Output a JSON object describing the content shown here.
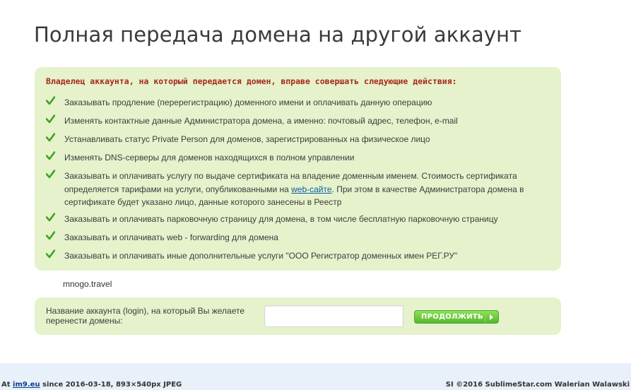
{
  "page": {
    "title": "Полная передача домена на другой аккаунт"
  },
  "rights": {
    "heading": "Владелец аккаунта, на который передается домен, вправе совершать следующие действия:",
    "items": [
      {
        "text": "Заказывать продление (перерегистрацию) доменного имени и оплачивать данную операцию"
      },
      {
        "text": "Изменять контактные данные Администратора домена, а именно: почтовый адрес, телефон, e-mail"
      },
      {
        "text": "Устанавливать статус Private Person для доменов, зарегистрированных на физическое лицо"
      },
      {
        "text": "Изменять DNS-серверы для доменов находящихся в полном управлении"
      },
      {
        "text_before": "Заказывать и оплачивать услугу по выдаче сертификата на владение доменным именем. Стоимость сертификата определяется тарифами на услуги, опубликованными на ",
        "link": "web-сайте",
        "text_after": ". При этом в качестве Администратора домена в сертификате будет указано лицо, данные которого занесены в Реестр"
      },
      {
        "text": "Заказывать и оплачивать парковочную страницу для домена, в том числе бесплатную парковочную страницу"
      },
      {
        "text": "Заказывать и оплачивать web - forwarding для домена"
      },
      {
        "text": "Заказывать и оплачивать иные дополнительные услуги \"ООО Регистратор доменных имен РЕГ.РУ\""
      }
    ]
  },
  "domain": {
    "name": "mnogo.travel"
  },
  "login_form": {
    "label": "Название аккаунта (login), на который Вы желаете перенести домены:",
    "input_value": "",
    "input_placeholder": "",
    "button_label": "ПРОДОЛЖИТЬ"
  },
  "footer": {
    "prefix": "At ",
    "site": "im9.eu",
    "suffix": " since 2016-03-18, 893×540px JPEG",
    "right": "SI ©2016 SublimeStar.com Walerian Walawski"
  },
  "colors": {
    "accent_green": "#55b82a",
    "box_background": "#e6f2cc",
    "heading_red": "#a52a1a",
    "link_blue": "#0d5da8"
  },
  "icons": {
    "check": "check-icon",
    "arrow": "arrow-right-icon"
  }
}
